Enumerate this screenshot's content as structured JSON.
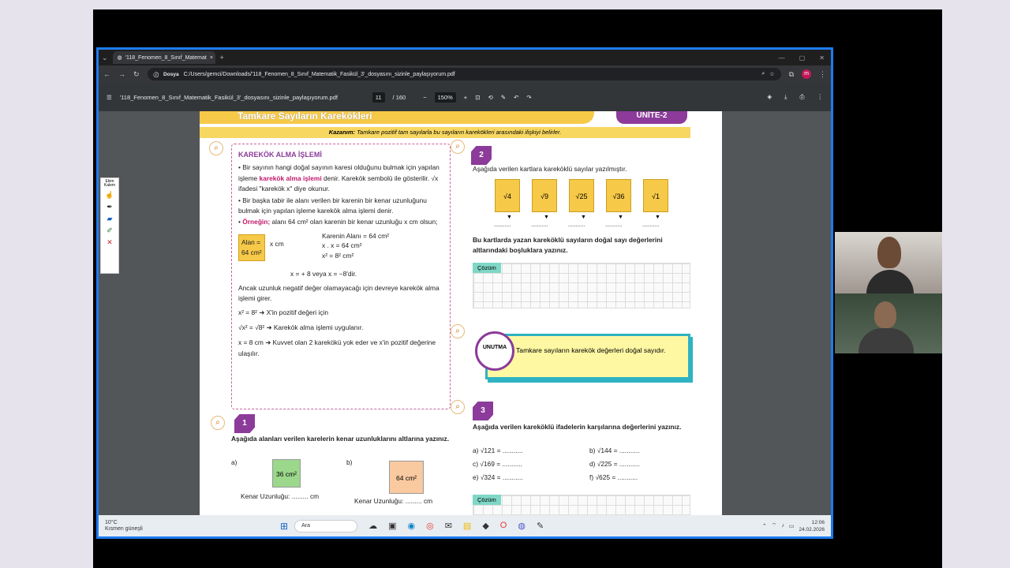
{
  "browser": {
    "tab_title": "'118_Fenomen_8_Sınıf_Matemat",
    "url_pill": "Dosya",
    "url": "C:/Users/gemci/Downloads/'118_Fenomen_8_Sınıf_Matematik_Fasikül_3'_dosyasını_sizinle_paylaşıyorum.pdf",
    "avatar": "m"
  },
  "pdf": {
    "file_name": "'118_Fenomen_8_Sınıf_Matematik_Fasikül_3'_dosyasını_sizinle_paylaşıyorum.pdf",
    "page_current": "11",
    "page_total": "/ 160",
    "zoom": "150%"
  },
  "page": {
    "header": "Tamkare Sayıların Karekökleri",
    "unit": "ÜNİTE-2",
    "kazanim_label": "Kazanım:",
    "kazanim": "Tamkare pozitif tam sayılarla bu sayıların karekökleri arasındaki ilişkiyi belirler.",
    "box": {
      "title": "KAREKÖK ALMA İŞLEMİ",
      "p1a": "Bir sayının hangi doğal sayının karesi olduğunu bulmak için yapılan işleme ",
      "p1b": "karekök alma işlemi",
      "p1c": " denir. Karekök sembolü ile gösterilir. √x ifadesi \"karekök x\" diye okunur.",
      "p2": "Bir başka tabir ile alanı verilen bir karenin bir kenar uzunluğunu bulmak için yapılan işleme karekök alma işlemi denir.",
      "ex_label": "Örneğin;",
      "ex": " alanı 64 cm² olan karenin bir kenar uzunluğu x cm olsun;",
      "alan": "Alan =\n64 cm²",
      "xcm": "x cm",
      "k1": "Karenin Alanı = 64 cm²",
      "k2": "x . x  = 64 cm²",
      "k3": "x²     = 8² cm²",
      "k4": "x = + 8 veya x = −8'dir.",
      "p3": "Ancak uzunluk negatif değer olamayacağı için devreye karekök alma işlemi girer.",
      "r1": "x² = 8² ➜ X'in pozitif değeri için",
      "r2": "√x² = √8² ➜ Karekök alma işlemi uygulanır.",
      "r3": "x = 8 cm ➜  Kuvvet olan 2 karekökü yok eder ve x'in pozitif değerine ulaşılır."
    },
    "q1": {
      "num": "1",
      "text": "Aşağıda alanları verilen karelerin kenar uzunluklarını altlarına yazınız.",
      "a": "a)",
      "b": "b)",
      "sq_a": "36 cm²",
      "sq_b": "64 cm²",
      "label_a": "Kenar Uzunluğu: ......... cm",
      "label_b": "Kenar Uzunluğu: ......... cm"
    },
    "q2": {
      "num": "2",
      "text": "Aşağıda verilen kartlara kareköklü sayılar yazılmıştır.",
      "cards": [
        "√4",
        "√9",
        "√25",
        "√36",
        "√1"
      ],
      "dots": "...........",
      "text2": "Bu kartlarda yazan kareköklü sayıların doğal sayı değerlerini altlarındaki boşluklara yazınız.",
      "cozum": "Çözüm"
    },
    "unutma": {
      "badge": "UNUTMA",
      "text": "Tamkare sayıların karekök değerleri doğal sayıdır."
    },
    "q3": {
      "num": "3",
      "text": "Aşağıda verilen kareköklü ifadelerin karşılarına değerlerini yazınız.",
      "items": [
        "a) √121 = ...........",
        "b) √144 = ...........",
        "c) √169 = ...........",
        "d) √225 = ...........",
        "e) √324 = ...........",
        "f) √625 = ..........."
      ],
      "cozum": "Çözüm"
    }
  },
  "taskbar": {
    "temp": "10°C",
    "weather": "Kısmen güneşli",
    "search": "Ara",
    "time": "12:06",
    "date": "24.02.2026"
  },
  "toolbox": {
    "label": "Ekim Kalem"
  }
}
